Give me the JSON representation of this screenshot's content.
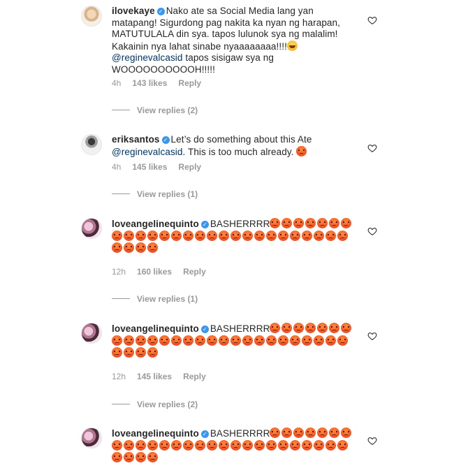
{
  "comments": [
    {
      "username": "ilovekaye",
      "text_1": "Nako ate sa Social Media lang yan matapang! Sigurdong pag nakita ka nyan ng harapan, MATUTULALA din sya. tapos lulunok sya ng malalim! Kakainin nya lahat sinabe nyaaaaaaaa!!!!",
      "mention": "@reginevalcasid",
      "text_2": " tapos sisigaw sya ng WOOOOOOOOOOH!!!!!",
      "time": "4h",
      "likes": "143 likes",
      "reply": "Reply",
      "view_replies": "View replies (2)"
    },
    {
      "username": "eriksantos",
      "text_1": "Let’s do something about this Ate ",
      "mention": "@reginevalcasid",
      "text_2": ". This is too much already.",
      "time": "4h",
      "likes": "145 likes",
      "reply": "Reply",
      "view_replies": "View replies (1)"
    },
    {
      "username": "loveangelinequinto",
      "text_1": "BASHERRRR",
      "time": "12h",
      "likes": "160 likes",
      "reply": "Reply",
      "view_replies": "View replies (1)"
    },
    {
      "username": "loveangelinequinto",
      "text_1": "BASHERRRR",
      "time": "12h",
      "likes": "145 likes",
      "reply": "Reply",
      "view_replies": "View replies (2)"
    },
    {
      "username": "loveangelinequinto",
      "text_1": "BASHERRRR"
    }
  ],
  "colors": {
    "verified": "#3897f0",
    "meta": "#999999",
    "mention": "#003569",
    "emoji_angry": "#f04a1f"
  },
  "icons": {
    "verified": "verified-badge-icon",
    "heart": "heart-outline-icon",
    "emoji": "angry-face-emoji"
  }
}
